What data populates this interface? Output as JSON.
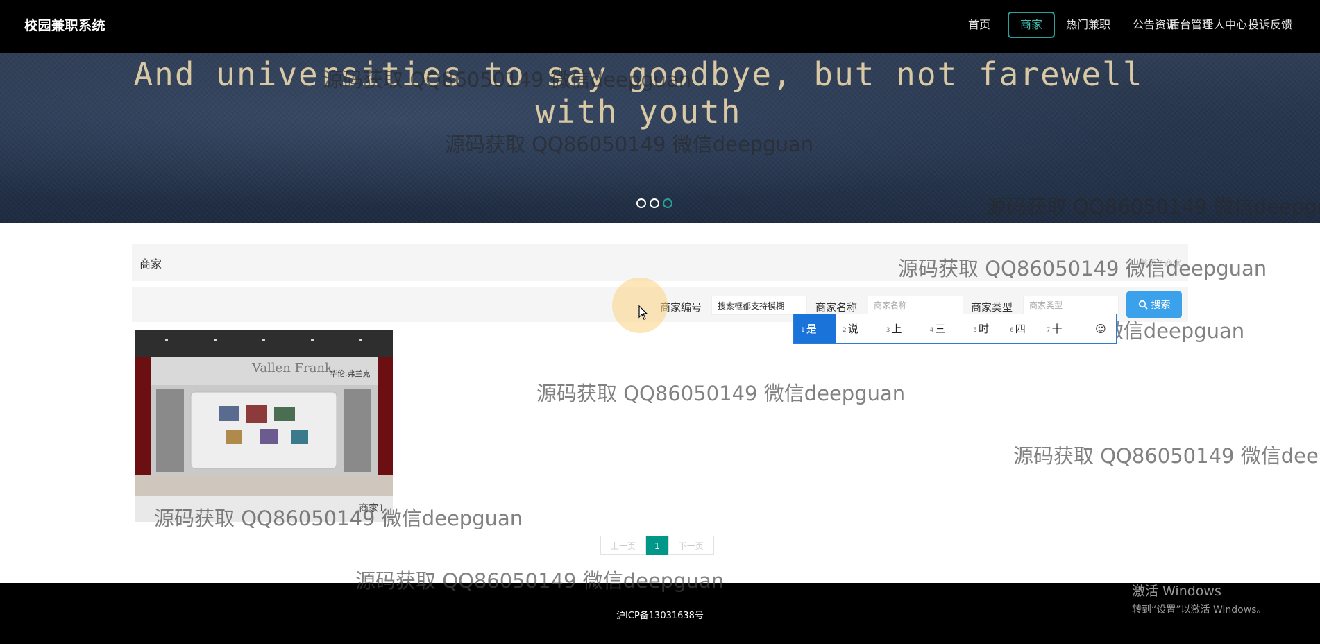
{
  "app": {
    "brand": "校园兼职系统"
  },
  "nav": {
    "items": [
      {
        "label": "首页",
        "active": false
      },
      {
        "label": "商家",
        "active": true
      },
      {
        "label": "热门兼职",
        "active": false
      },
      {
        "label": "公告资讯",
        "active": false
      },
      {
        "label": "个人中心",
        "active": false
      },
      {
        "label": "后台管理",
        "active": false
      },
      {
        "label": "投诉反馈",
        "active": false
      }
    ]
  },
  "banner": {
    "slogan": "And universities to say goodbye, but not farewell with youth",
    "slides": 3,
    "active_slide": 3
  },
  "section": {
    "title": "商家",
    "breadcrumb": "首页 / 商家"
  },
  "search": {
    "fields": [
      {
        "label": "商家编号",
        "value": "搜索框都支持模糊",
        "placeholder": ""
      },
      {
        "label": "商家名称",
        "value": "",
        "placeholder": "商家名称"
      },
      {
        "label": "商家类型",
        "value": "",
        "placeholder": "商家类型"
      }
    ],
    "button_label": "搜索"
  },
  "ime": {
    "candidates": [
      {
        "n": "1",
        "text": "是"
      },
      {
        "n": "2",
        "text": "说"
      },
      {
        "n": "3",
        "text": "上"
      },
      {
        "n": "4",
        "text": "三"
      },
      {
        "n": "5",
        "text": "时"
      },
      {
        "n": "6",
        "text": "四"
      },
      {
        "n": "7",
        "text": "十"
      }
    ],
    "extra": "☺"
  },
  "cards": [
    {
      "name": "商家1",
      "store_sign": "Vallen Frank",
      "store_sign_cn": "华伦.弗兰克"
    }
  ],
  "pagination": {
    "prev": "上一页",
    "current": "1",
    "next": "下一页"
  },
  "footer": {
    "icp": "沪ICP备13031638号"
  },
  "os_notice": {
    "title": "激活 Windows",
    "subtitle": "转到“设置”以激活 Windows。"
  },
  "watermark": "源码获取 QQ86050149 微信deepguan"
}
